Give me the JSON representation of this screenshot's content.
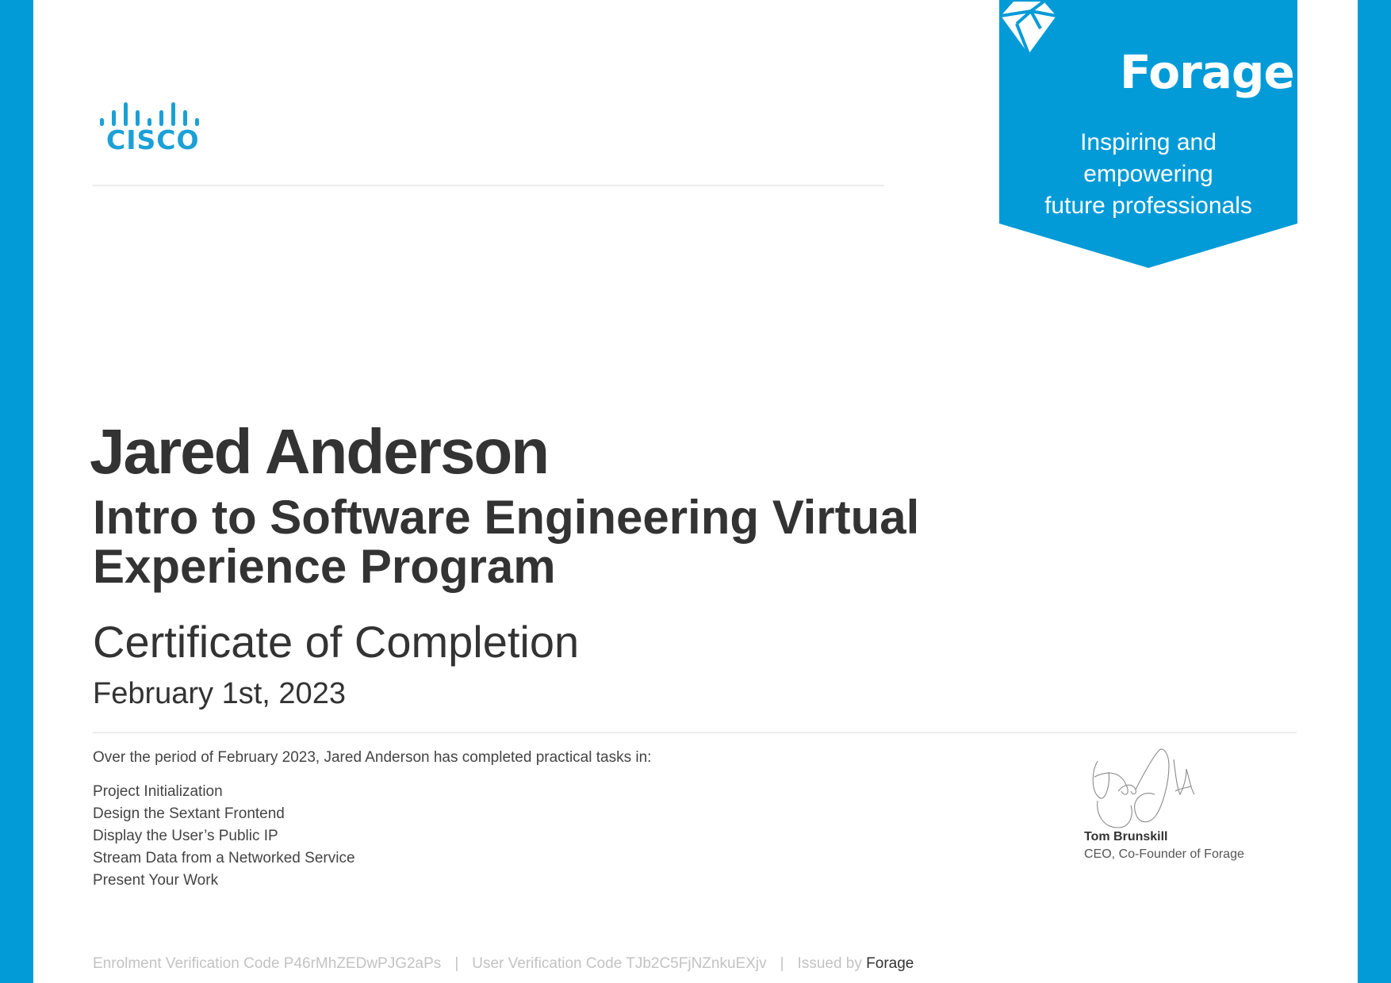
{
  "colors": {
    "brand_blue": "#039bd7",
    "cisco_blue": "#1ba0d7",
    "text_dark": "#333333",
    "footer_gray": "#c3c3c3"
  },
  "cisco_logo": {
    "icon": "cisco-bars-logo",
    "wordmark": "CISCO"
  },
  "forage_badge": {
    "icon": "forage-gem-logo",
    "wordmark": "Forage",
    "tagline": [
      "Inspiring and",
      "empowering",
      "future professionals"
    ]
  },
  "recipient": {
    "name": "Jared Anderson"
  },
  "program": {
    "title": "Intro to Software Engineering Virtual Experience Program"
  },
  "certificate": {
    "title": "Certificate of Completion",
    "date": "February 1st, 2023"
  },
  "summary": {
    "period_text": "Over the period of February 2023, Jared Anderson has completed practical tasks in:",
    "tasks": [
      "Project Initialization",
      "Design the Sextant Frontend",
      "Display the User’s Public IP",
      "Stream Data from a Networked Service",
      "Present Your Work"
    ]
  },
  "signatory": {
    "signature": "handwritten-signature",
    "name": "Tom Brunskill",
    "title": "CEO, Co-Founder of Forage"
  },
  "footer": {
    "enrolment_code": "Enrolment Verification Code P46rMhZEDwPJG2aPs",
    "separator": "|",
    "user_code": "User Verification Code TJb2C5FjNZnkuEXjv",
    "issued_by_label": "Issued by",
    "issuer": "Forage"
  }
}
